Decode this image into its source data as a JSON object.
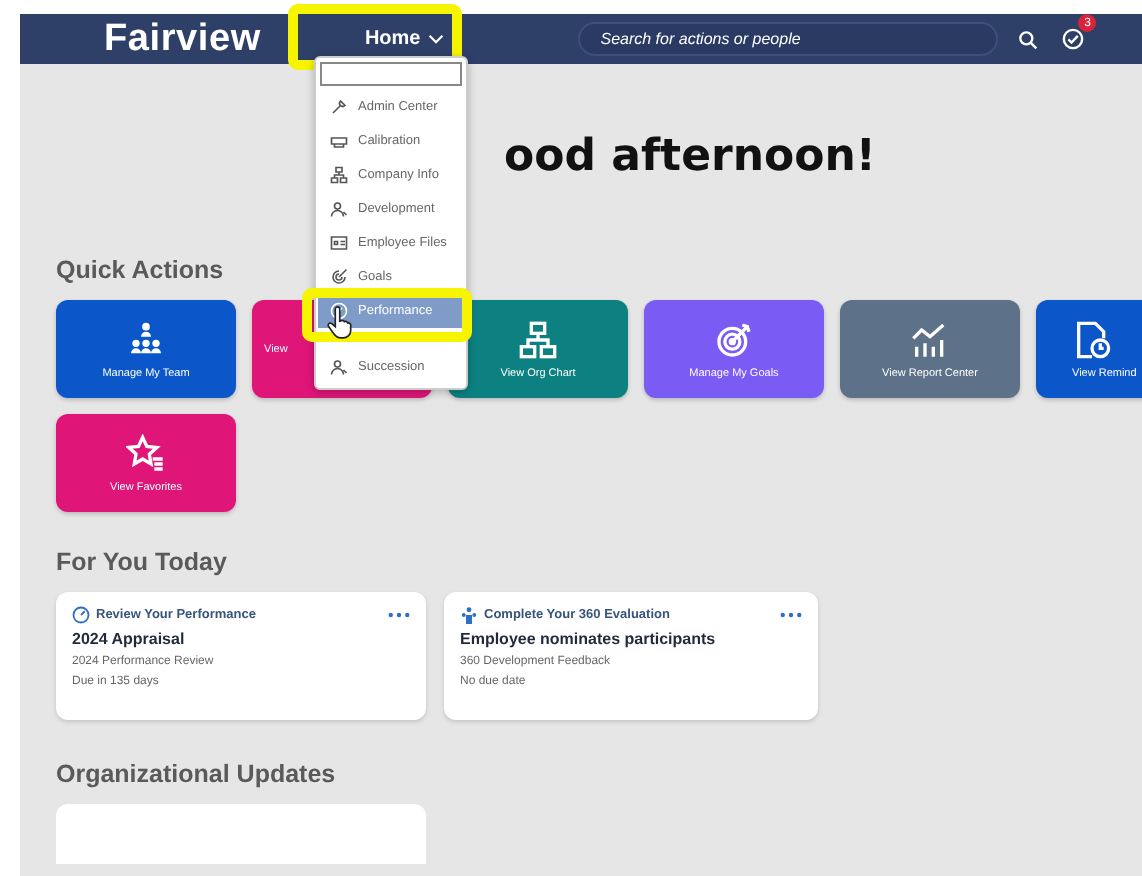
{
  "header": {
    "logo": "Fairview",
    "nav": {
      "label": "Home",
      "highlighted": true
    },
    "search": {
      "placeholder": "Search for actions or people"
    },
    "notifications": {
      "badge": "3"
    }
  },
  "menu": {
    "items": [
      {
        "kind": "search"
      },
      {
        "kind": "item",
        "label": "Admin Center",
        "selected": false,
        "highlighted": false
      },
      {
        "kind": "item",
        "label": "Calibration",
        "selected": false,
        "highlighted": false
      },
      {
        "kind": "item",
        "label": "Company Info",
        "selected": false,
        "highlighted": false
      },
      {
        "kind": "item",
        "label": "Development",
        "selected": false,
        "highlighted": false
      },
      {
        "kind": "item",
        "label": "Employee Files",
        "selected": false,
        "highlighted": false
      },
      {
        "kind": "item",
        "label": "Goals",
        "selected": false,
        "highlighted": false
      },
      {
        "kind": "item",
        "label": "Performance",
        "selected": true,
        "highlighted": true
      },
      {
        "kind": "gap"
      },
      {
        "kind": "item",
        "label": "Succession",
        "selected": false,
        "highlighted": false
      }
    ]
  },
  "greeting": "ood afternoon!",
  "quick_actions": {
    "title": "Quick Actions",
    "tiles": [
      {
        "kind": "full",
        "label": "Manage My Team",
        "color": "#0b56c9"
      },
      {
        "kind": "covered",
        "label": "View",
        "color": "#df1578"
      },
      {
        "kind": "full",
        "label": "View Org Chart",
        "color": "#0d8182"
      },
      {
        "kind": "full",
        "label": "Manage My Goals",
        "color": "#7a5cf4"
      },
      {
        "kind": "full",
        "label": "View Report Center",
        "color": "#5d7189"
      },
      {
        "kind": "cut",
        "label": "View Remind",
        "color": "#0b56c9"
      },
      {
        "kind": "full",
        "label": "View Favorites",
        "color": "#df1578"
      }
    ]
  },
  "for_you_today": {
    "title": "For You Today",
    "cards": [
      {
        "category": "Review Your Performance",
        "title": "2024 Appraisal",
        "subtitle": "2024 Performance Review",
        "due": "Due in 135 days"
      },
      {
        "category": "Complete Your 360 Evaluation",
        "title": "Employee nominates participants",
        "subtitle": "360 Development Feedback",
        "due": "No due date"
      }
    ]
  },
  "organizational_updates": {
    "title": "Organizational Updates"
  }
}
